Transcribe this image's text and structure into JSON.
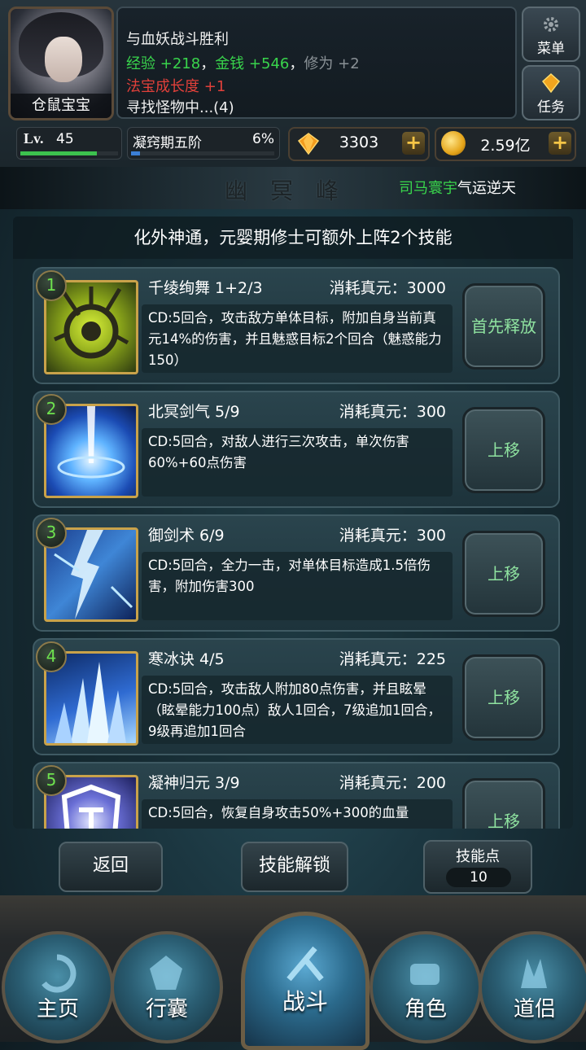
{
  "player": {
    "name": "仓鼠宝宝",
    "level_prefix": "Lv.",
    "level": "45",
    "level_progress": 0.78,
    "stage": "凝窍期五阶",
    "stage_percent": "6%",
    "stage_progress": 0.06
  },
  "battle_log": {
    "line1": "与血妖战斗胜利",
    "exp_label": "经验",
    "exp_value": "+218",
    "sep1": "，",
    "gold_label": "金钱",
    "gold_value": "+546",
    "sep2": "，",
    "cult_label": "修为",
    "cult_value": "+2",
    "treasure_label": "法宝成长度",
    "treasure_value": "+1",
    "line4": "寻找怪物中...(4)"
  },
  "side_buttons": {
    "menu": "菜单",
    "tasks": "任务"
  },
  "currency": {
    "gems": "3303",
    "gold": "2.59亿",
    "plus": "+"
  },
  "title": {
    "text": "幽冥峰",
    "ticker_name": "司马寰宇",
    "ticker_text": "气运逆天"
  },
  "notice": "化外神通，元婴期修士可额外上阵2个技能",
  "skills": [
    {
      "num": "1",
      "name": "千绫绚舞 1+2/3",
      "cost": "消耗真元：3000",
      "desc": "CD:5回合，攻击敌方单体目标，附加自身当前真元14%的伤害，并且魅惑目标2个回合（魅惑能力150）",
      "action": "首先释放"
    },
    {
      "num": "2",
      "name": "北冥剑气 5/9",
      "cost": "消耗真元：300",
      "desc": "CD:5回合，对敌人进行三次攻击，单次伤害60%+60点伤害",
      "action": "上移"
    },
    {
      "num": "3",
      "name": "御剑术 6/9",
      "cost": "消耗真元：300",
      "desc": "CD:5回合，全力一击，对单体目标造成1.5倍伤害，附加伤害300",
      "action": "上移"
    },
    {
      "num": "4",
      "name": "寒冰诀 4/5",
      "cost": "消耗真元：225",
      "desc": "CD:5回合，攻击敌人附加80点伤害，并且眩晕（眩晕能力100点）敌人1回合，7级追加1回合，9级再追加1回合",
      "action": "上移"
    },
    {
      "num": "5",
      "name": "凝神归元 3/9",
      "cost": "消耗真元：200",
      "desc": "CD:5回合，恢复自身攻击50%+300的血量",
      "action": "上移"
    }
  ],
  "bottom": {
    "back": "返回",
    "unlock": "技能解锁",
    "points_label": "技能点",
    "points_value": "10"
  },
  "nav": {
    "home": "主页",
    "bag": "行囊",
    "battle": "战斗",
    "role": "角色",
    "partner": "道侣"
  },
  "colors": {
    "accent_green": "#39d44c",
    "red": "#e0403a",
    "gold": "#c9a24a",
    "action_text": "#8fe3a0"
  }
}
